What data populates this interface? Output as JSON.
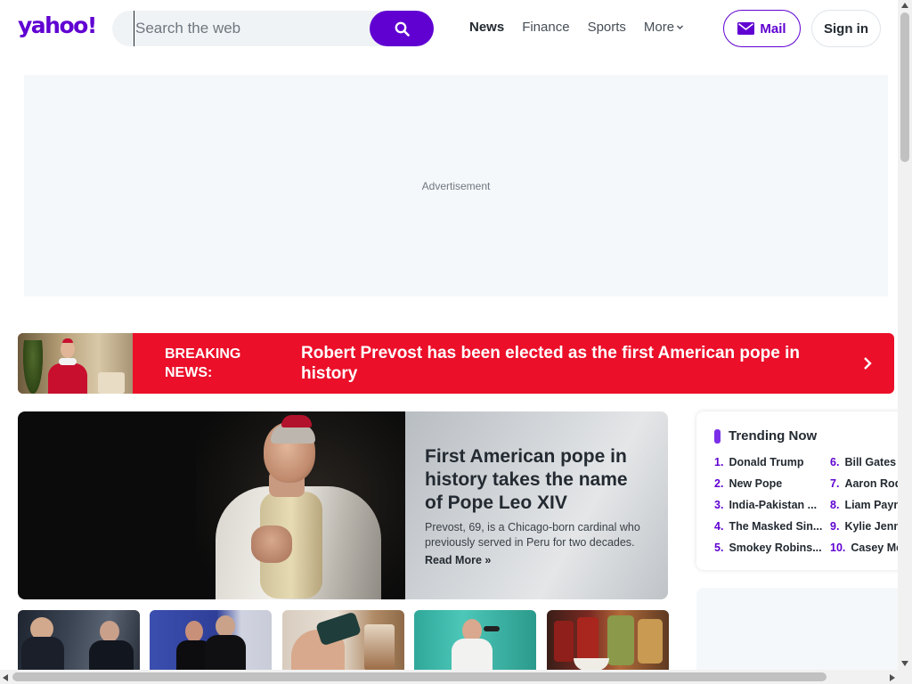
{
  "header": {
    "logo": "yahoo!",
    "search": {
      "placeholder": "Search the web"
    },
    "nav": [
      {
        "label": "News"
      },
      {
        "label": "Finance"
      },
      {
        "label": "Sports"
      },
      {
        "label": "More"
      }
    ],
    "mail_label": "Mail",
    "signin_label": "Sign in"
  },
  "ad": {
    "label": "Advertisement"
  },
  "breaking": {
    "label": "BREAKING NEWS:",
    "headline": "Robert Prevost has been elected as the first American pope in history"
  },
  "hero": {
    "title": "First American pope in history takes the name of Pope Leo XIV",
    "description": "Prevost, 69, is a Chicago-born cardinal who previously served in Peru for two decades.",
    "read_more": "Read More »"
  },
  "trending": {
    "title": "Trending Now",
    "items": [
      {
        "rank": "1.",
        "label": "Donald Trump"
      },
      {
        "rank": "2.",
        "label": "New Pope"
      },
      {
        "rank": "3.",
        "label": "India-Pakistan ..."
      },
      {
        "rank": "4.",
        "label": "The Masked Sin..."
      },
      {
        "rank": "5.",
        "label": "Smokey Robins..."
      },
      {
        "rank": "6.",
        "label": "Bill Gates"
      },
      {
        "rank": "7.",
        "label": "Aaron Rod"
      },
      {
        "rank": "8.",
        "label": "Liam Payn"
      },
      {
        "rank": "9.",
        "label": "Kylie Jenn"
      },
      {
        "rank": "10.",
        "label": "Casey Me"
      }
    ]
  },
  "colors": {
    "brand": "#6001d2",
    "breaking_red": "#eb0f29",
    "trending_accent": "#7b2ee8"
  },
  "icons": {
    "search": "search-icon",
    "mail": "mail-icon",
    "more": "chevron-down-icon",
    "breaking_arrow": "chevron-right-icon"
  }
}
